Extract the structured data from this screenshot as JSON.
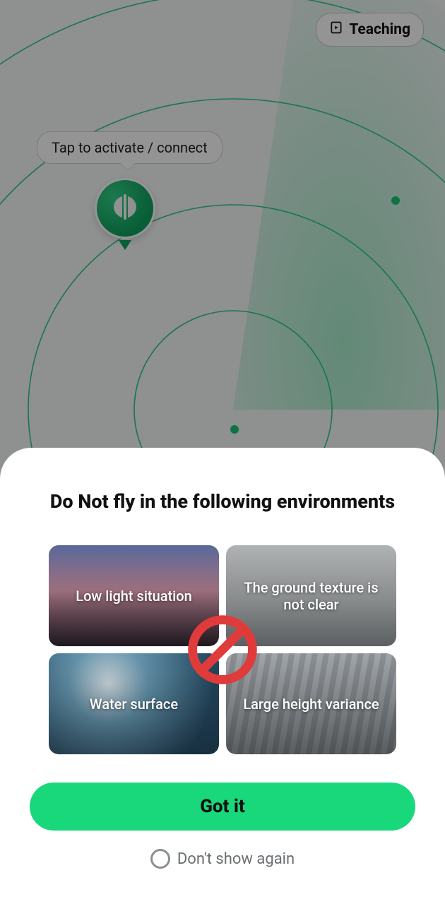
{
  "header": {
    "teaching_label": "Teaching"
  },
  "tooltip": {
    "text": "Tap to activate / connect"
  },
  "modal": {
    "title": "Do Not fly in the following environments",
    "cards": [
      {
        "label": "Low light situation"
      },
      {
        "label": "The ground texture is not clear"
      },
      {
        "label": "Water surface"
      },
      {
        "label": "Large height variance"
      }
    ],
    "primary_button": "Got it",
    "dont_show_label": "Don't show again"
  },
  "colors": {
    "accent_green": "#19d87b",
    "brand_green_dark": "#0fa25e"
  }
}
